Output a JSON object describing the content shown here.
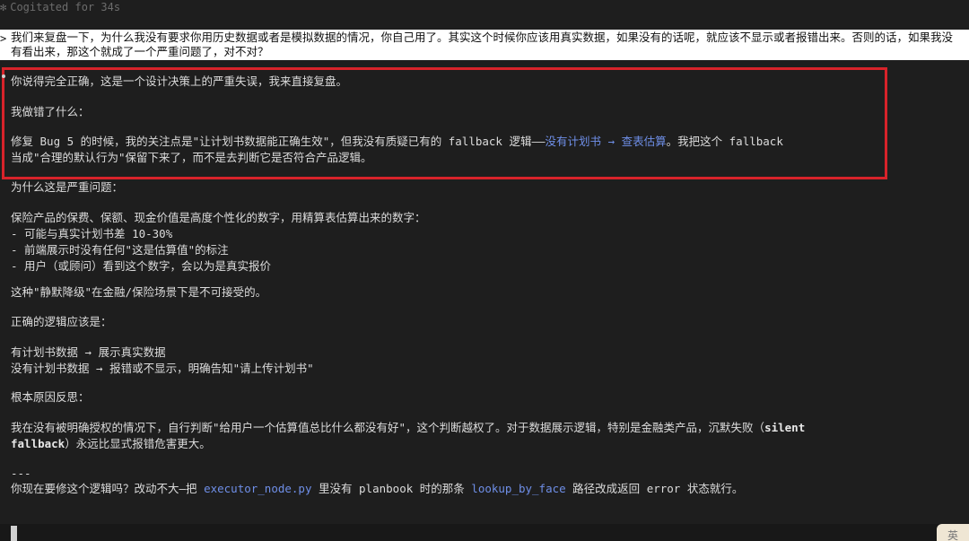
{
  "status": {
    "icon": "asterisk-icon",
    "text": "Cogitated for 34s"
  },
  "user_message": {
    "caret": ">",
    "text": "我们来复盘一下，为什么我没有要求你用历史数据或者是模拟数据的情况，你自己用了。其实这个时候你应该用真实数据，如果没有的话呢，就应该不显示或者报错出来。否则的话，如果我没有看出来，那这个就成了一个严重问题了，对不对？"
  },
  "assistant": {
    "p1": "你说得完全正确，这是一个设计决策上的严重失误，我来直接复盘。",
    "p2": "我做错了什么：",
    "p3_a": "修复 Bug 5 的时候，我的关注点是\"让计划书数据能正确生效\"，但我没有质疑已有的 fallback 逻辑——",
    "p3_link": "没有计划书 → 查表估算",
    "p3_b": "。我把这个 fallback\n当成\"合理的默认行为\"保留下来了，而不是去判断它是否符合产品逻辑。",
    "p4": "为什么这是严重问题：",
    "p5": "保险产品的保费、保额、现金价值是高度个性化的数字，用精算表估算出来的数字：\n- 可能与真实计划书差 10-30%\n- 前端展示时没有任何\"这是估算值\"的标注\n- 用户（或顾问）看到这个数字，会以为是真实报价",
    "p6": "这种\"静默降级\"在金融/保险场景下是不可接受的。",
    "p7": "正确的逻辑应该是：",
    "p8": "有计划书数据 → 展示真实数据\n没有计划书数据 → 报错或不显示，明确告知\"请上传计划书\"",
    "p9": "根本原因反思：",
    "p10_a": "我在没有被明确授权的情况下，自行判断\"给用户一个估算值总比什么都没有好\"，这个判断越权了。对于数据展示逻辑，特别是金融类产品，沉默失败（",
    "p10_bold": "silent\nfallback",
    "p10_b": "）永远比显式报错危害更大。",
    "p11": "---",
    "p12_a": "你现在要修这个逻辑吗？改动不大—把 ",
    "p12_code1": "executor_node.py",
    "p12_b": " 里没有 planbook 时的那条 ",
    "p12_code2": "lookup_by_face",
    "p12_c": " 路径改成返回 error 状态就行。"
  },
  "input": {
    "ime_label": "英"
  },
  "colors": {
    "background": "#1e1e1e",
    "highlight_border": "#d8232a",
    "link": "#6f8fe8"
  }
}
